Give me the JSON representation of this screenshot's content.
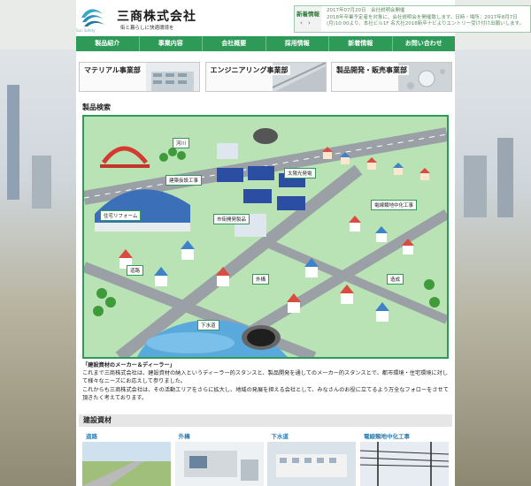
{
  "brand": {
    "name": "三商株式会社",
    "tagline": "街と暮らしに快適環境を",
    "small_caption": "Sun Safety"
  },
  "news": {
    "label": "新着情報",
    "prev_arrow": "‹",
    "next_arrow": "›",
    "lines": [
      "2017年07月20日　会社説明会開催",
      "2018年卒業予定者を対象に、会社説明会を開催致します。日時・場所：2017年8月7日",
      "(月)10:00より、本社ビル1F 名大社2018新卒ナビよりエントリー受け付け出願いします。"
    ]
  },
  "nav": [
    "製品紹介",
    "事業内容",
    "会社概要",
    "採用情報",
    "新着情報",
    "お問い合わせ"
  ],
  "divisions": [
    "マテリアル事業部",
    "エンジニアリング事業部",
    "製品開発・販売事業部"
  ],
  "product_search": {
    "title": "製品検索",
    "labels": [
      "河川",
      "建築仮設工事",
      "太陽光発電",
      "住宅リフォーム",
      "市街開発製品",
      "電線類地中化工事",
      "道路",
      "外構",
      "造成",
      "下水道"
    ]
  },
  "intro": {
    "heading": "「建設資材のメーカー＆ディーラー」",
    "paragraph1": "これまで三商株式会社は、建設資材の納入というディーラー的スタンスと、製品開発を通してのメーカー的スタンスとで、都市環境・住宅環境に対して様々なニーズにお応えして参りました。",
    "paragraph2": "これからも三商株式会社は、その活動エリアをさらに拡大し、地域の発展を担える会社として、みなさんのお役に立てるよう万全なフォローをさせて頂きたく考えております。"
  },
  "materials": {
    "title": "建設資材",
    "cards": [
      "道路",
      "外構",
      "下水道",
      "電線類地中化工事"
    ]
  },
  "colors": {
    "brand_green": "#2d9a58",
    "link_blue": "#2d7fb5"
  }
}
